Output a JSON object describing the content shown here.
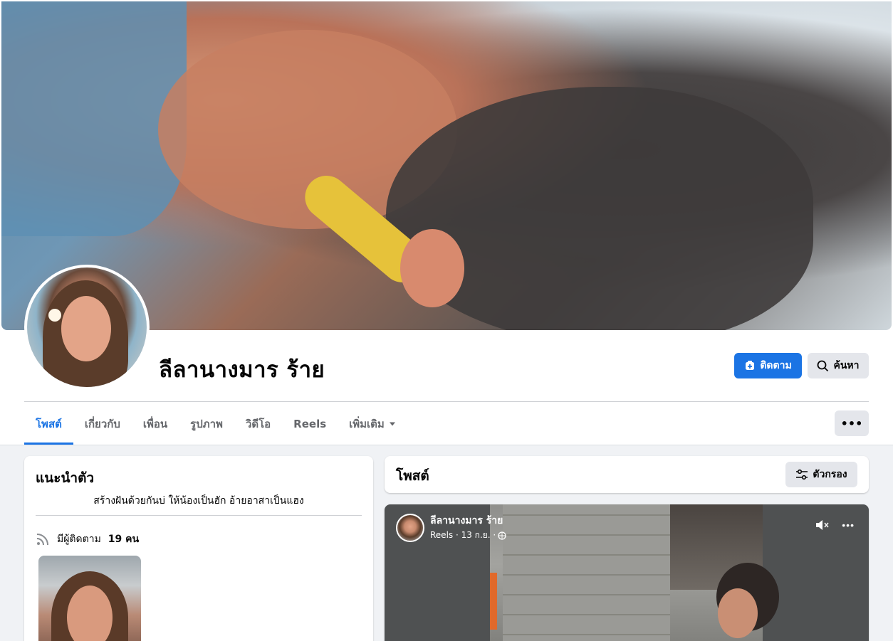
{
  "profile": {
    "name": "ลีลานางมาร ร้าย"
  },
  "actions": {
    "follow_label": "ติดตาม",
    "search_label": "ค้นหา",
    "more_label": "•••"
  },
  "tabs": [
    {
      "label": "โพสต์",
      "active": true
    },
    {
      "label": "เกี่ยวกับ"
    },
    {
      "label": "เพื่อน"
    },
    {
      "label": "รูปภาพ"
    },
    {
      "label": "วิดีโอ"
    },
    {
      "label": "Reels"
    },
    {
      "label": "เพิ่มเติม"
    }
  ],
  "intro": {
    "title": "แนะนำตัว",
    "bio": "สร้างฝันด้วยกันบ่ ให้น้องเป็นฮัก อ้ายอาสาเป็นแฮง",
    "followers_prefix": "มีผู้ติดตาม",
    "followers_count": "19 คน"
  },
  "posts": {
    "title": "โพสต์",
    "filter_label": "ตัวกรอง"
  },
  "reel": {
    "author": "ลีลานางมาร ร้าย",
    "meta": "Reels · 13 ก.ย. ·",
    "more_label": "•••"
  },
  "colors": {
    "accent": "#1b74e4",
    "background": "#f0f2f5",
    "button_gray": "#e4e6eb",
    "text_secondary": "#65676b"
  },
  "icons": {
    "follow": "user-plus-icon",
    "search": "search-icon",
    "filter": "filter-sliders-icon",
    "followers": "rss-icon",
    "muted": "speaker-muted-icon",
    "privacy": "globe-icon",
    "dropdown": "caret-down-icon"
  }
}
